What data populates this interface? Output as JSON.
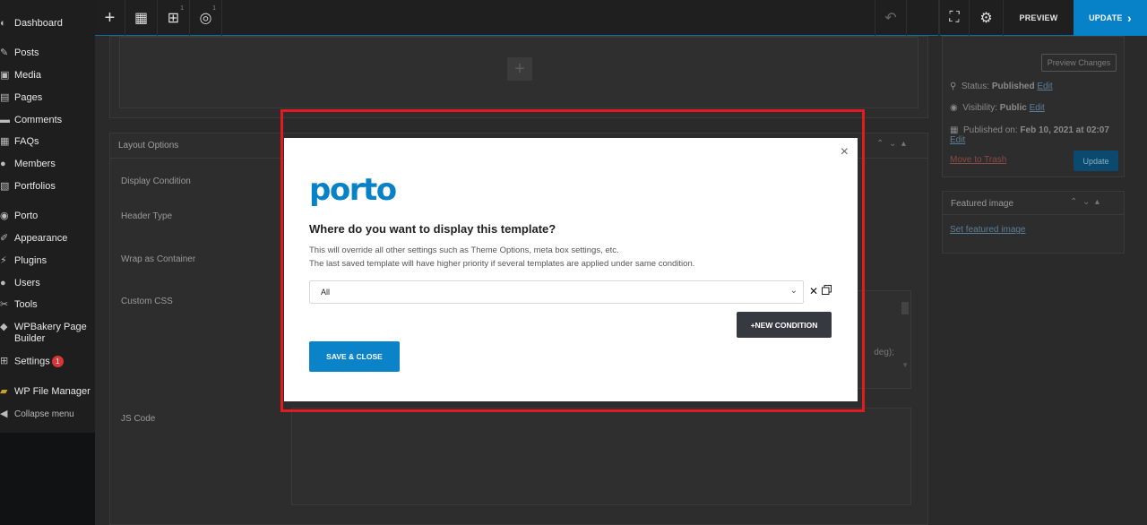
{
  "sidebar": {
    "items": [
      {
        "icon": "dashboard-icon",
        "glyph": "◐",
        "label": "Dashboard"
      },
      {
        "icon": "posts-icon",
        "glyph": "✎",
        "label": "Posts"
      },
      {
        "icon": "media-icon",
        "glyph": "▣",
        "label": "Media"
      },
      {
        "icon": "pages-icon",
        "glyph": "▤",
        "label": "Pages"
      },
      {
        "icon": "comments-icon",
        "glyph": "▬",
        "label": "Comments"
      },
      {
        "icon": "faqs-icon",
        "glyph": "▦",
        "label": "FAQs"
      },
      {
        "icon": "members-icon",
        "glyph": "●",
        "label": "Members"
      },
      {
        "icon": "portfolios-icon",
        "glyph": "▧",
        "label": "Portfolios"
      },
      {
        "icon": "porto-icon",
        "glyph": "◉",
        "label": "Porto"
      },
      {
        "icon": "appearance-icon",
        "glyph": "✐",
        "label": "Appearance"
      },
      {
        "icon": "plugins-icon",
        "glyph": "⚡",
        "label": "Plugins"
      },
      {
        "icon": "users-icon",
        "glyph": "●",
        "label": "Users"
      },
      {
        "icon": "tools-icon",
        "glyph": "✂",
        "label": "Tools"
      },
      {
        "icon": "wpbakery-icon",
        "glyph": "◆",
        "label": "WPBakery Page Builder"
      },
      {
        "icon": "settings-icon",
        "glyph": "⊞",
        "label": "Settings",
        "badge": "1"
      },
      {
        "icon": "file-manager-icon",
        "glyph": "▰",
        "label": "WP File Manager"
      },
      {
        "icon": "collapse-icon",
        "glyph": "◀",
        "label": "Collapse menu"
      }
    ]
  },
  "toolbar": {
    "add_glyph": "+",
    "layout_glyph": "▦",
    "navigator_glyph": "⊞",
    "navigator_count": "1",
    "conditions_glyph": "◎",
    "conditions_count": "1",
    "undo_glyph": "↶",
    "fullscreen_glyph": "⛶",
    "settings_glyph": "⚙",
    "preview_label": "PREVIEW",
    "update_label": "UPDATE",
    "update_arrow": "›"
  },
  "background": {
    "add_glyph": "+",
    "layout_options_title": "Layout Options",
    "fields": [
      "Display Condition",
      "Header Type",
      "Wrap as Container",
      "Custom CSS",
      "JS Code"
    ],
    "css_snippet": "deg);",
    "publish": {
      "preview_changes": "Preview Changes",
      "status_label": "Status:",
      "status_value": "Published",
      "status_edit": "Edit",
      "visibility_label": "Visibility:",
      "visibility_value": "Public",
      "visibility_edit": "Edit",
      "published_label": "Published on:",
      "published_value": "Feb 10, 2021 at 02:07",
      "published_edit": "Edit",
      "trash": "Move to Trash",
      "update": "Update"
    },
    "featured_image_title": "Featured image",
    "set_featured_image": "Set featured image"
  },
  "modal": {
    "logo_text": "porto",
    "close_glyph": "×",
    "title": "Where do you want to display this template?",
    "desc_line1": "This will override all other settings such as Theme Options, meta box settings, etc.",
    "desc_line2": "The last saved template will have higher priority if several templates are applied under same condition.",
    "condition_value": "All",
    "select_chevron": "⌄",
    "remove_glyph": "✕",
    "new_condition_label": "+NEW CONDITION",
    "save_close_label": "SAVE & CLOSE"
  },
  "colors": {
    "accent": "#0b83c8",
    "highlight_border": "#e21b23",
    "dark_button": "#363a40",
    "badge": "#d63638"
  }
}
